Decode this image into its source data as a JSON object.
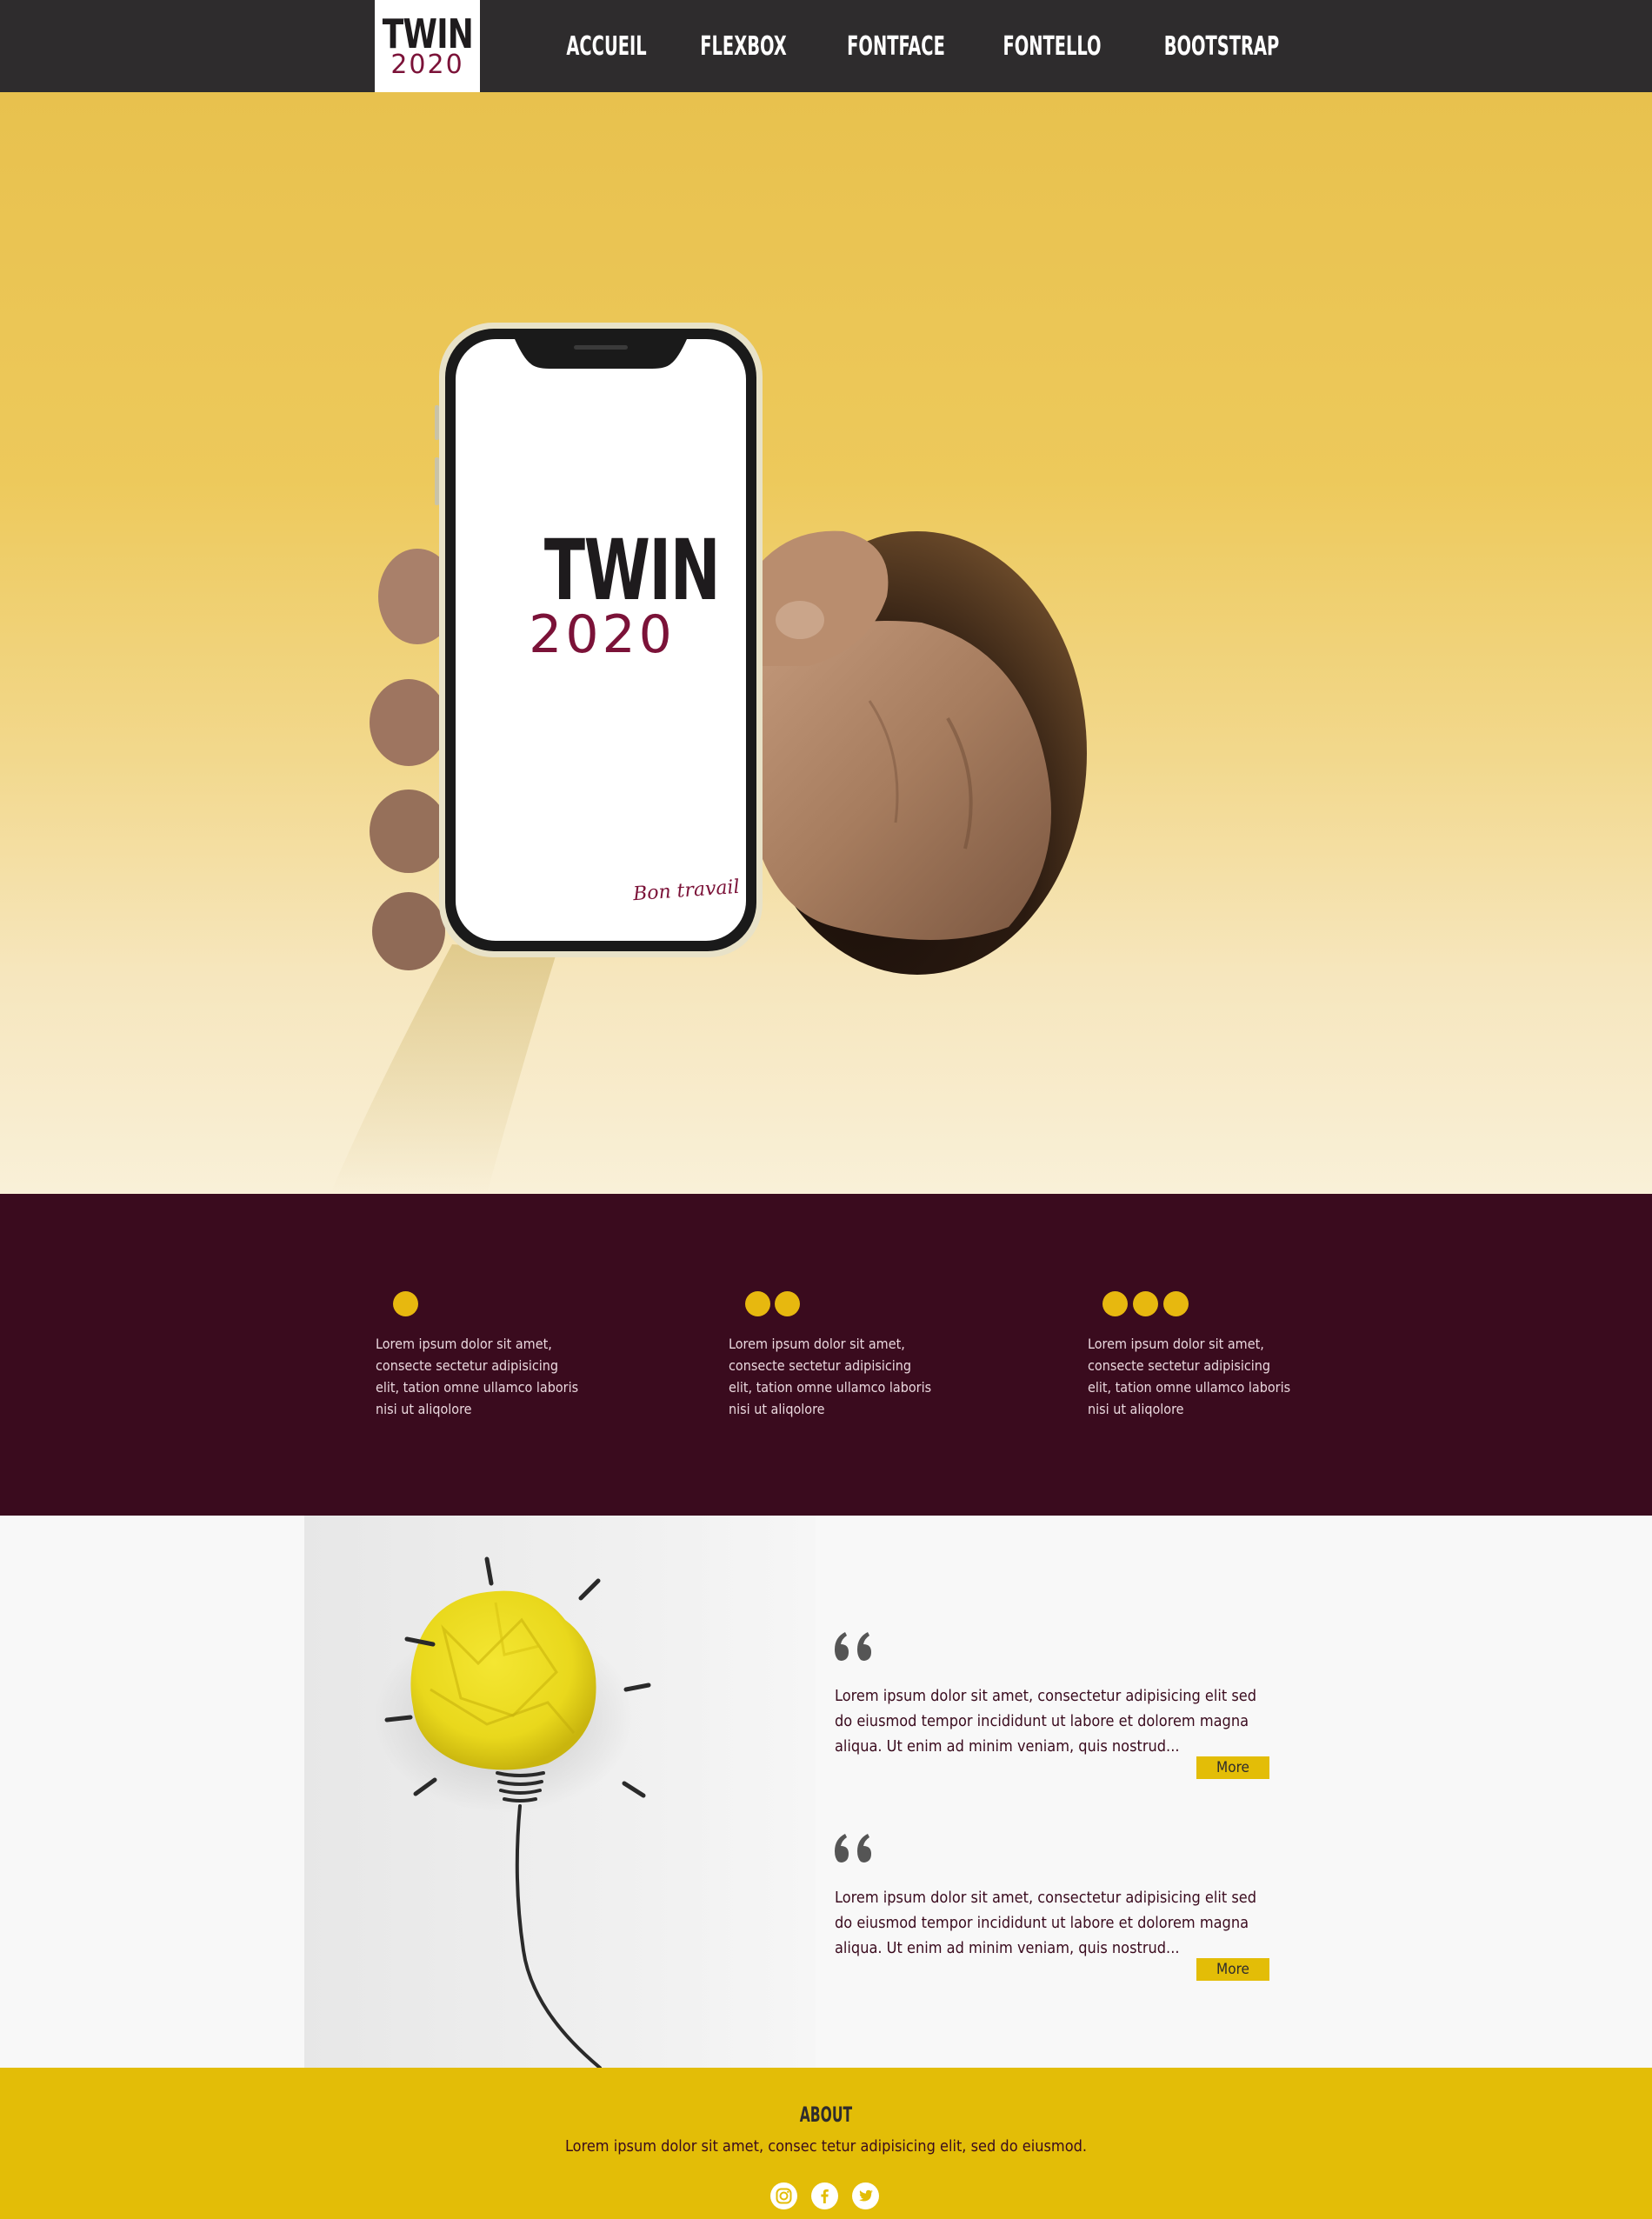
{
  "nav": {
    "logo": {
      "word": "TWIN",
      "year": "2020"
    },
    "items": [
      {
        "label": "ACCUEIL"
      },
      {
        "label": "FLEXBOX"
      },
      {
        "label": "FONTFACE"
      },
      {
        "label": "FONTELLO"
      },
      {
        "label": "BOOTSTRAP"
      }
    ]
  },
  "hero": {
    "phone_logo_word": "TWIN",
    "phone_logo_year": "2020",
    "phone_tagline": "Bon travail"
  },
  "features": [
    {
      "dots": 1,
      "text": "Lorem ipsum dolor sit amet, consecte sectetur adipisicing elit, tation omne ullamco laboris nisi ut aliqolore"
    },
    {
      "dots": 2,
      "text": "Lorem ipsum dolor sit amet, consecte sectetur adipisicing elit, tation omne ullamco laboris nisi ut aliqolore"
    },
    {
      "dots": 3,
      "text": "Lorem ipsum dolor sit amet, consecte sectetur adipisicing elit, tation omne ullamco laboris nisi ut aliqolore"
    }
  ],
  "testimonials": [
    {
      "text": "Lorem ipsum dolor sit amet, consectetur adipisicing elit sed do eiusmod tempor incididunt ut labore et dolorem magna aliqua. Ut enim ad minim veniam, quis nostrud...",
      "button": "More"
    },
    {
      "text": "Lorem ipsum dolor sit amet, consectetur adipisicing elit sed do eiusmod tempor incididunt ut labore et dolorem magna aliqua. Ut enim ad minim veniam, quis nostrud...",
      "button": "More"
    }
  ],
  "footer": {
    "title": "ABOUT",
    "text": "Lorem ipsum dolor sit amet, consec tetur adipisicing elit, sed do eiusmod.",
    "socials": [
      {
        "icon": "instagram-icon"
      },
      {
        "icon": "facebook-icon"
      },
      {
        "icon": "twitter-icon"
      }
    ]
  },
  "colors": {
    "nav_bg": "#2e2c2d",
    "brand_wine": "#3a0b1e",
    "accent_yellow": "#e3bd07",
    "dot_yellow": "#e7b80f",
    "logo_year": "#7b1238"
  }
}
